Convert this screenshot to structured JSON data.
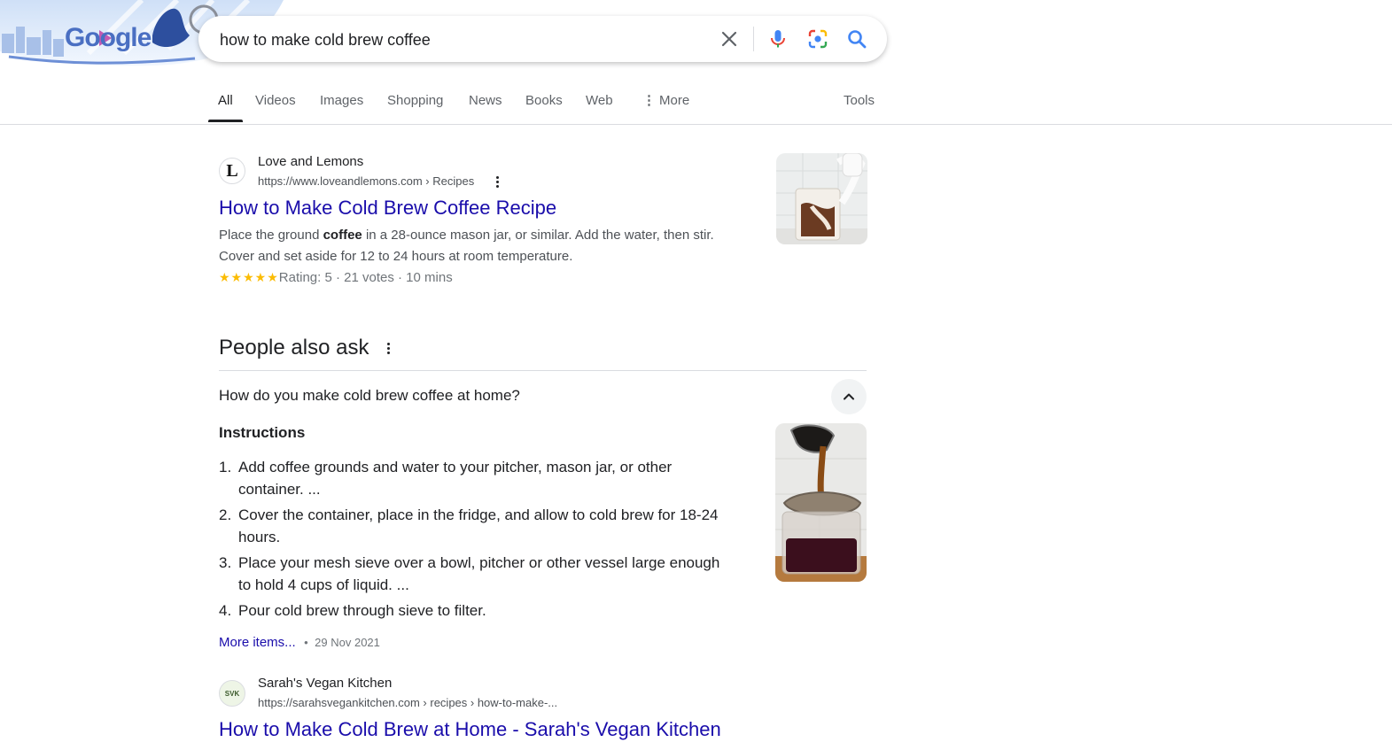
{
  "search": {
    "query": "how to make cold brew coffee",
    "doodle_text": "Google"
  },
  "tabs": [
    {
      "label": "All"
    },
    {
      "label": "Videos"
    },
    {
      "label": "Images"
    },
    {
      "label": "Shopping"
    },
    {
      "label": "News"
    },
    {
      "label": "Books"
    },
    {
      "label": "Web"
    },
    {
      "label": "More"
    }
  ],
  "tools_label": "Tools",
  "results": [
    {
      "favicon_letter": "L",
      "site": "Love and Lemons",
      "url": "https://www.loveandlemons.com › Recipes",
      "title": "How to Make Cold Brew Coffee Recipe",
      "snippet_line1_pre": "Place the ground ",
      "snippet_line1_bold": "coffee",
      "snippet_line1_post": " in a 28-ounce mason jar, or similar. Add the water, then stir.",
      "snippet_line2": "Cover and set aside for 12 to 24 hours at room temperature.",
      "stars": "★★★★★",
      "rating": "Rating: 5 · 21 votes · 10 mins"
    },
    {
      "favicon_letter": "SVK",
      "site": "Sarah's Vegan Kitchen",
      "url": "https://sarahsvegankitchen.com › recipes › how-to-make-...",
      "title": "How to Make Cold Brew at Home - Sarah's Vegan Kitchen"
    }
  ],
  "paa": {
    "heading": "People also ask",
    "question": "How do you make cold brew coffee at home?",
    "instructions_heading": "Instructions",
    "steps": [
      {
        "num": "1.",
        "line1": "Add coffee grounds and water to your pitcher, mason jar, or other",
        "line2": "container. ..."
      },
      {
        "num": "2.",
        "line1": "Cover the container, place in the fridge, and allow to cold brew for 18-24",
        "line2": "hours."
      },
      {
        "num": "3.",
        "line1": "Place your mesh sieve over a bowl, pitcher or other vessel large enough",
        "line2": "to hold 4 cups of liquid. ..."
      },
      {
        "num": "4.",
        "line1": "Pour cold brew through sieve to filter.",
        "line2": ""
      }
    ],
    "more_items": "More items...",
    "bullet": "•",
    "date": "29 Nov 2021"
  },
  "colors": {
    "link": "#1a0dab",
    "star": "#fbbc04"
  }
}
